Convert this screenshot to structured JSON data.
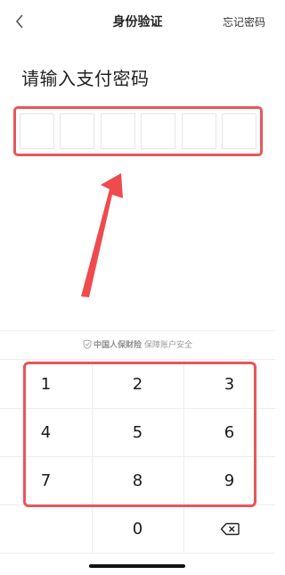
{
  "nav": {
    "back_icon": "chevron-left-icon",
    "title": "身份验证",
    "forgot_password": "忘记密码"
  },
  "prompt": "请输入支付密码",
  "pin": {
    "length": 6,
    "filled": 0
  },
  "insurer": {
    "icon": "shield-check-icon",
    "brand": "中国人保财险",
    "text": "保障账户安全"
  },
  "keypad": {
    "keys": [
      "1",
      "2",
      "3",
      "4",
      "5",
      "6",
      "7",
      "8",
      "9",
      "",
      "0",
      "⌫"
    ],
    "delete_icon": "backspace-icon"
  },
  "colors": {
    "highlight": "#e8575a",
    "arrow": "#ef4a4d"
  }
}
